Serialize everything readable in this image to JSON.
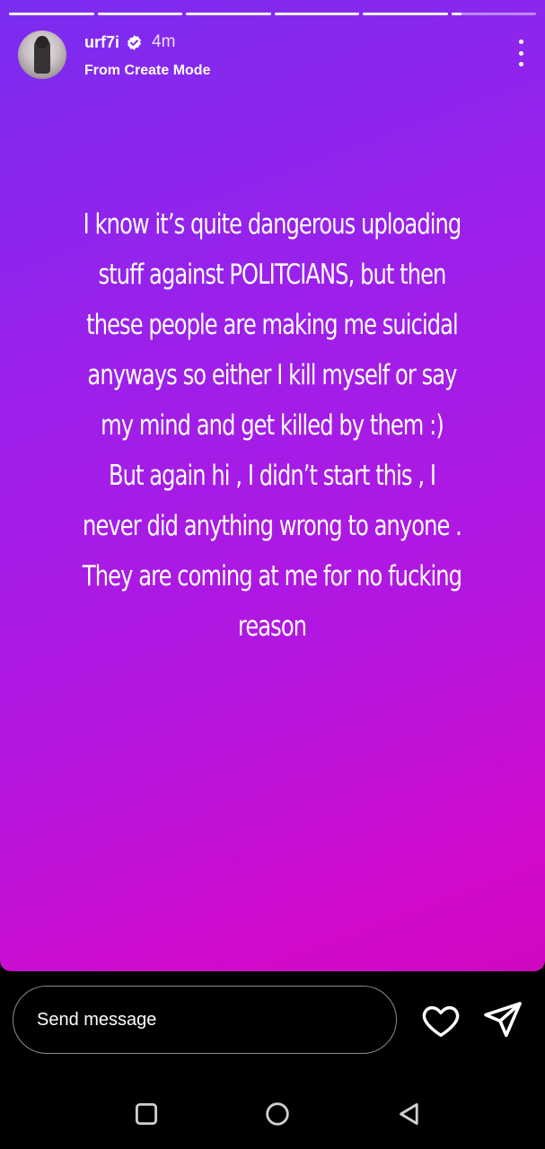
{
  "story": {
    "progress": [
      {
        "fraction": 1.0
      },
      {
        "fraction": 1.0
      },
      {
        "fraction": 1.0
      },
      {
        "fraction": 1.0
      },
      {
        "fraction": 1.0
      },
      {
        "fraction": 0.12
      }
    ],
    "gradient_colors": [
      "#7a2cf0",
      "#b316e0",
      "#d10acb"
    ],
    "text_lines": [
      "I know it’s quite dangerous uploading",
      "stuff against POLITCIANS, but then",
      "these people are making me suicidal",
      "anyways so either I kill myself or say",
      "my mind and get killed by them :)",
      "But again hi , I didn’t start this , I",
      "never did anything wrong to anyone .",
      "They are coming at me for no fucking",
      "reason"
    ]
  },
  "header": {
    "username": "urf7i",
    "verified": true,
    "time_ago": "4m",
    "subtitle": "From Create Mode",
    "avatar_icon": "profile-avatar",
    "more_icon": "more-vertical-icon"
  },
  "composer": {
    "placeholder": "Send message",
    "like_icon": "heart-icon",
    "send_icon": "send-icon"
  },
  "system_nav": {
    "recents_icon": "square-icon",
    "home_icon": "circle-icon",
    "back_icon": "triangle-back-icon"
  }
}
